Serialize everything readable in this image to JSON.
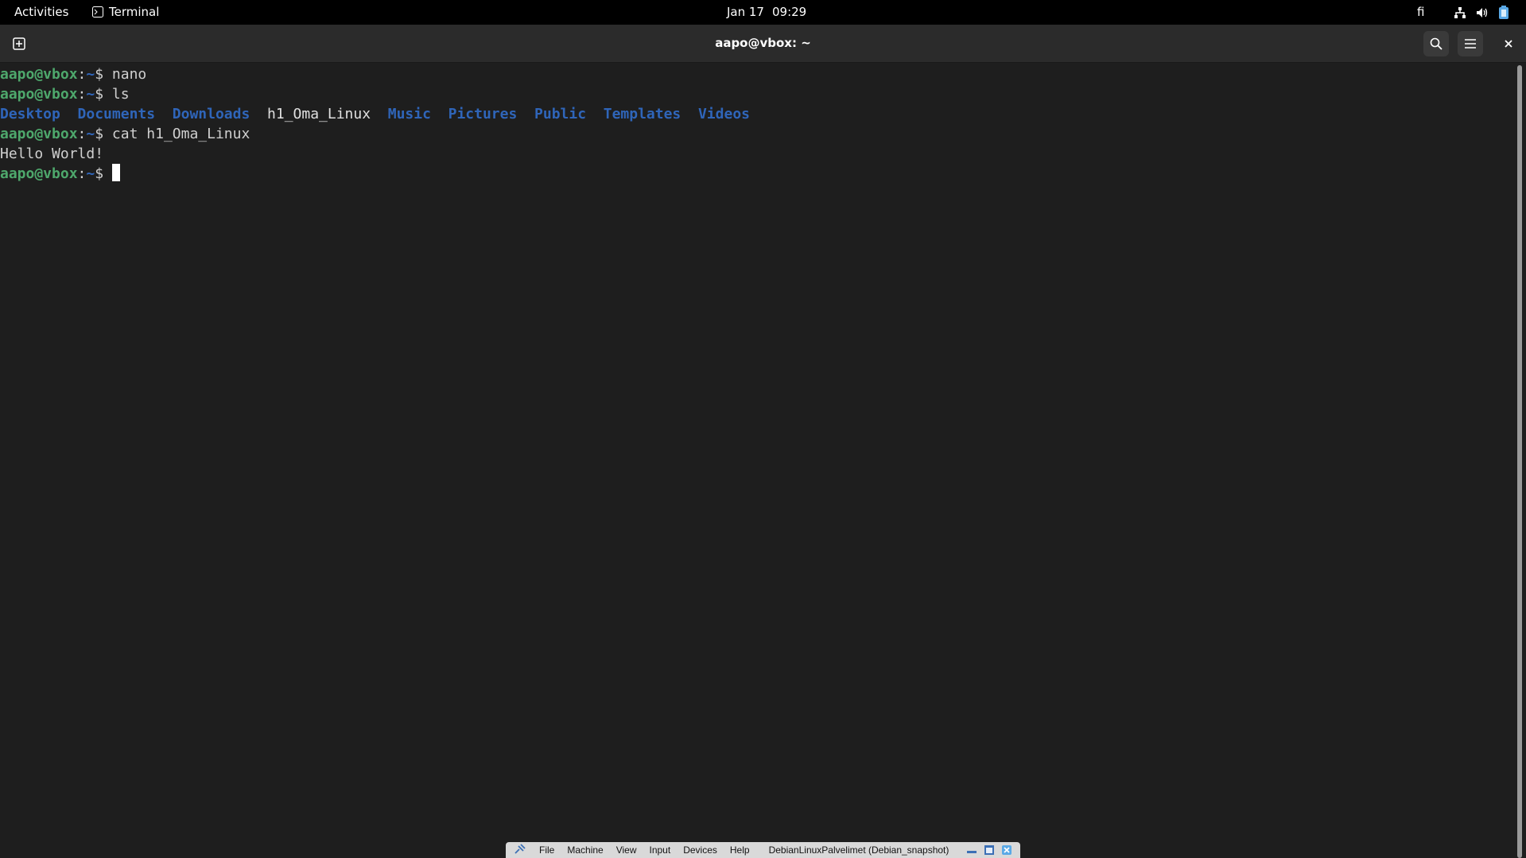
{
  "topbar": {
    "activities": "Activities",
    "app_name": "Terminal",
    "date": "Jan 17",
    "time": "09:29",
    "keyboard_layout": "fi",
    "tray_icons": [
      "network-icon",
      "volume-icon",
      "battery-icon"
    ]
  },
  "window": {
    "title": "aapo@vbox: ~",
    "buttons": [
      "new-tab-icon",
      "search-icon",
      "hamburger-menu-icon",
      "close-icon"
    ]
  },
  "terminal": {
    "prompt_user": "aapo@vbox",
    "prompt_path": "~",
    "prompt_symbol": "$",
    "cmd1": "nano",
    "cmd2": "ls",
    "ls_entries": [
      {
        "name": "Desktop",
        "type": "dir"
      },
      {
        "name": "Documents",
        "type": "dir"
      },
      {
        "name": "Downloads",
        "type": "dir"
      },
      {
        "name": "h1_Oma_Linux",
        "type": "file"
      },
      {
        "name": "Music",
        "type": "dir"
      },
      {
        "name": "Pictures",
        "type": "dir"
      },
      {
        "name": "Public",
        "type": "dir"
      },
      {
        "name": "Templates",
        "type": "dir"
      },
      {
        "name": "Videos",
        "type": "dir"
      }
    ],
    "cmd3": "cat h1_Oma_Linux",
    "output": "Hello World!",
    "colors": {
      "user": "#4ea86c",
      "dir": "#2f65b9",
      "text": "#d0d0d0"
    }
  },
  "vbox_bar": {
    "menu": [
      "File",
      "Machine",
      "View",
      "Input",
      "Devices",
      "Help"
    ],
    "vm_name": "DebianLinuxPalvelimet (Debian_snapshot)"
  }
}
